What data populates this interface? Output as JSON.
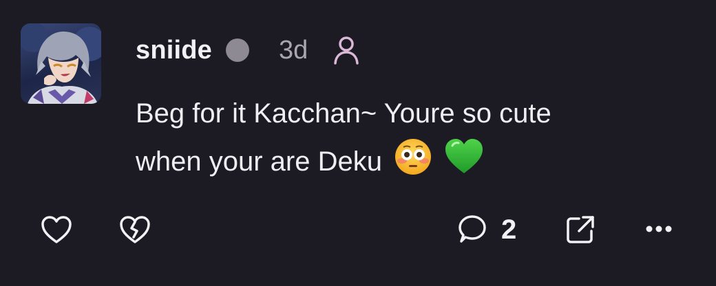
{
  "post": {
    "username": "sniide",
    "time": "3d",
    "comment_line1": "Beg for it Kacchan~ Youre so cute",
    "comment_line2": "when your are Deku",
    "emojis": [
      "flushed-face",
      "green-heart"
    ]
  },
  "actions": {
    "reply_count": "2"
  },
  "colors": {
    "background": "#1c1a23",
    "text": "#f2f1f5",
    "muted": "#a9a6b0",
    "status_dot": "#8d8a93",
    "user_icon": "#d9b8d8"
  }
}
